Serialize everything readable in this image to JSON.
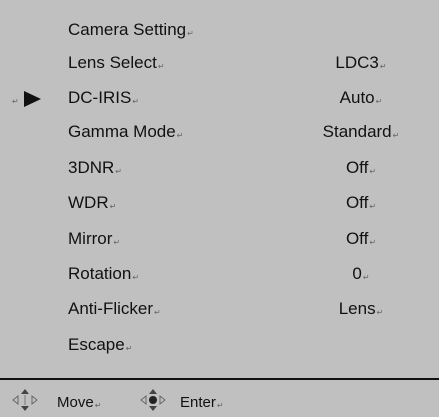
{
  "menu": {
    "title": "Camera Setting",
    "selected_index": 1,
    "items": [
      {
        "label": "Lens Select",
        "value": "LDC3"
      },
      {
        "label": "DC-IRIS",
        "value": "Auto"
      },
      {
        "label": "Gamma Mode",
        "value": "Standard"
      },
      {
        "label": "3DNR",
        "value": "Off"
      },
      {
        "label": "WDR",
        "value": "Off"
      },
      {
        "label": "Mirror",
        "value": "Off"
      },
      {
        "label": "Rotation",
        "value": "0"
      },
      {
        "label": "Anti-Flicker",
        "value": "Lens"
      },
      {
        "label": "Escape",
        "value": ""
      }
    ]
  },
  "footer": {
    "move_label": "Move",
    "enter_label": "Enter",
    "move_icon": "four-way-arrows-icon",
    "enter_icon": "enter-joystick-icon"
  },
  "colors": {
    "background": "#c0c0c0",
    "text": "#111111"
  }
}
